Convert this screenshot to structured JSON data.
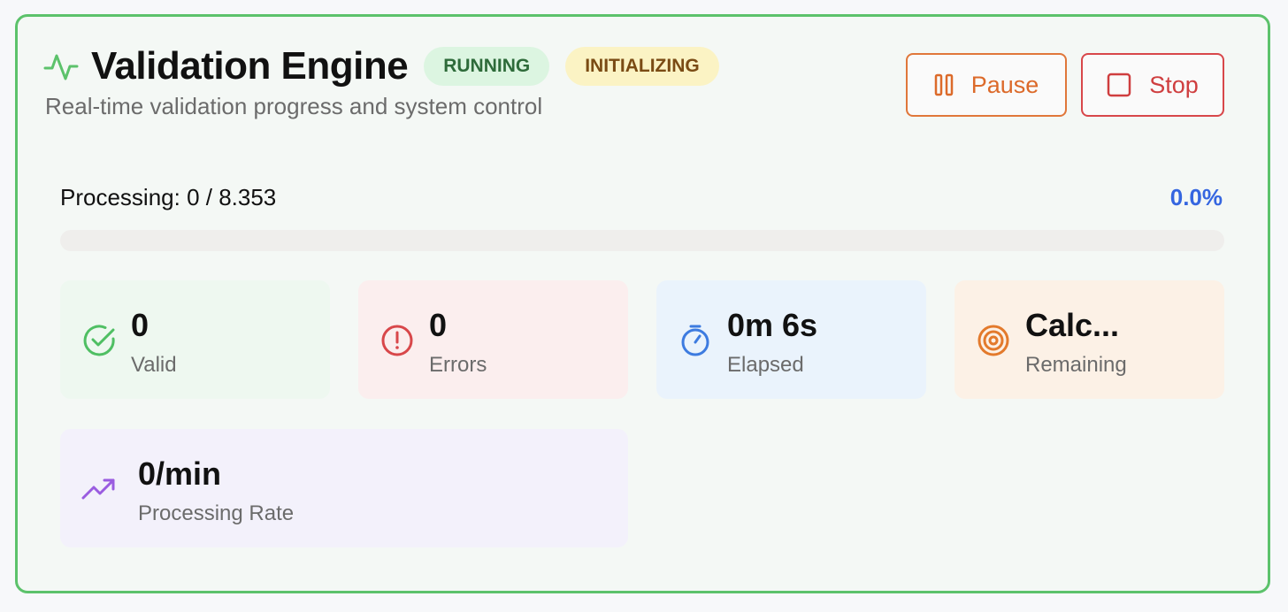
{
  "header": {
    "title": "Validation Engine",
    "subtitle": "Real-time validation progress and system control",
    "badges": [
      {
        "label": "RUNNING",
        "color": "#2e6b3a",
        "bg": "#dcf5e1"
      },
      {
        "label": "INITIALIZING",
        "color": "#7a4b14",
        "bg": "#fbf3c4"
      }
    ],
    "icon": "activity-icon"
  },
  "actions": {
    "pause_label": "Pause",
    "pause_icon": "pause-icon",
    "stop_label": "Stop",
    "stop_icon": "stop-icon"
  },
  "progress": {
    "label": "Processing: 0 / 8.353",
    "processed": 0,
    "total": 8353,
    "percent_text": "0.0%",
    "fraction": 0.0
  },
  "stats": {
    "valid": {
      "value": "0",
      "label": "Valid",
      "icon": "check-circle-icon",
      "color": "#4fbf63"
    },
    "errors": {
      "value": "0",
      "label": "Errors",
      "icon": "alert-circle-icon",
      "color": "#d8474a"
    },
    "elapsed": {
      "value": "0m 6s",
      "label": "Elapsed",
      "icon": "timer-icon",
      "color": "#3d7be0"
    },
    "remaining": {
      "value": "Calc...",
      "label": "Remaining",
      "icon": "target-icon",
      "color": "#e37a2c"
    },
    "rate": {
      "value": "0/min",
      "label": "Processing Rate",
      "icon": "trending-up-icon",
      "color": "#9a5ce0"
    }
  },
  "colors": {
    "border": "#5cc26b",
    "accent_blue": "#3566e0"
  }
}
